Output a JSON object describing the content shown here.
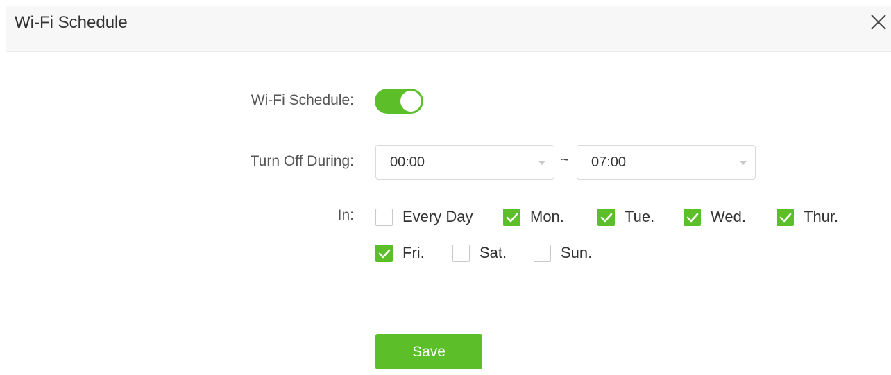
{
  "dialog": {
    "title": "Wi-Fi Schedule",
    "close_icon": "close-icon"
  },
  "form": {
    "schedule_label": "Wi-Fi Schedule:",
    "schedule_enabled": true,
    "turn_off_label": "Turn Off During:",
    "start_time": "00:00",
    "separator": "~",
    "end_time": "07:00",
    "in_label": "In:",
    "days": [
      {
        "label": "Every Day",
        "checked": false
      },
      {
        "label": "Mon.",
        "checked": true
      },
      {
        "label": "Tue.",
        "checked": true
      },
      {
        "label": "Wed.",
        "checked": true
      },
      {
        "label": "Thur.",
        "checked": true
      },
      {
        "label": "Fri.",
        "checked": true
      },
      {
        "label": "Sat.",
        "checked": false
      },
      {
        "label": "Sun.",
        "checked": false
      }
    ],
    "save_label": "Save"
  },
  "colors": {
    "accent": "#5cbf2a",
    "header_bg": "#f7f7f7"
  }
}
